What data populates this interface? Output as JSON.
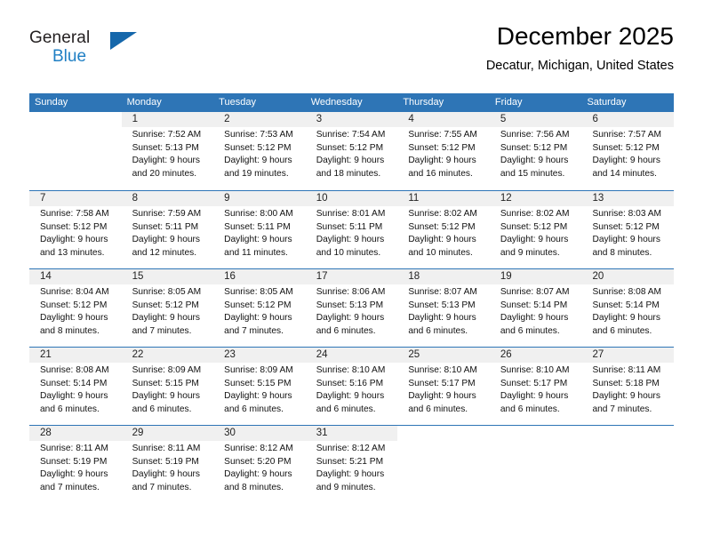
{
  "brand": {
    "name_part1": "General",
    "name_part2": "Blue",
    "triangle_color": "#1567ab",
    "blue_color": "#1f7fc4"
  },
  "header": {
    "title": "December 2025",
    "subtitle": "Decatur, Michigan, United States"
  },
  "theme": {
    "header_row_bg": "#2e75b6",
    "day_band_bg": "#f0f0f0",
    "separator_color": "#2e75b6",
    "page_bg": "#ffffff"
  },
  "weekdays": [
    "Sunday",
    "Monday",
    "Tuesday",
    "Wednesday",
    "Thursday",
    "Friday",
    "Saturday"
  ],
  "weeks": [
    [
      {
        "day": "",
        "l1": "",
        "l2": "",
        "l3": "",
        "l4": ""
      },
      {
        "day": "1",
        "l1": "Sunrise: 7:52 AM",
        "l2": "Sunset: 5:13 PM",
        "l3": "Daylight: 9 hours",
        "l4": "and 20 minutes."
      },
      {
        "day": "2",
        "l1": "Sunrise: 7:53 AM",
        "l2": "Sunset: 5:12 PM",
        "l3": "Daylight: 9 hours",
        "l4": "and 19 minutes."
      },
      {
        "day": "3",
        "l1": "Sunrise: 7:54 AM",
        "l2": "Sunset: 5:12 PM",
        "l3": "Daylight: 9 hours",
        "l4": "and 18 minutes."
      },
      {
        "day": "4",
        "l1": "Sunrise: 7:55 AM",
        "l2": "Sunset: 5:12 PM",
        "l3": "Daylight: 9 hours",
        "l4": "and 16 minutes."
      },
      {
        "day": "5",
        "l1": "Sunrise: 7:56 AM",
        "l2": "Sunset: 5:12 PM",
        "l3": "Daylight: 9 hours",
        "l4": "and 15 minutes."
      },
      {
        "day": "6",
        "l1": "Sunrise: 7:57 AM",
        "l2": "Sunset: 5:12 PM",
        "l3": "Daylight: 9 hours",
        "l4": "and 14 minutes."
      }
    ],
    [
      {
        "day": "7",
        "l1": "Sunrise: 7:58 AM",
        "l2": "Sunset: 5:12 PM",
        "l3": "Daylight: 9 hours",
        "l4": "and 13 minutes."
      },
      {
        "day": "8",
        "l1": "Sunrise: 7:59 AM",
        "l2": "Sunset: 5:11 PM",
        "l3": "Daylight: 9 hours",
        "l4": "and 12 minutes."
      },
      {
        "day": "9",
        "l1": "Sunrise: 8:00 AM",
        "l2": "Sunset: 5:11 PM",
        "l3": "Daylight: 9 hours",
        "l4": "and 11 minutes."
      },
      {
        "day": "10",
        "l1": "Sunrise: 8:01 AM",
        "l2": "Sunset: 5:11 PM",
        "l3": "Daylight: 9 hours",
        "l4": "and 10 minutes."
      },
      {
        "day": "11",
        "l1": "Sunrise: 8:02 AM",
        "l2": "Sunset: 5:12 PM",
        "l3": "Daylight: 9 hours",
        "l4": "and 10 minutes."
      },
      {
        "day": "12",
        "l1": "Sunrise: 8:02 AM",
        "l2": "Sunset: 5:12 PM",
        "l3": "Daylight: 9 hours",
        "l4": "and 9 minutes."
      },
      {
        "day": "13",
        "l1": "Sunrise: 8:03 AM",
        "l2": "Sunset: 5:12 PM",
        "l3": "Daylight: 9 hours",
        "l4": "and 8 minutes."
      }
    ],
    [
      {
        "day": "14",
        "l1": "Sunrise: 8:04 AM",
        "l2": "Sunset: 5:12 PM",
        "l3": "Daylight: 9 hours",
        "l4": "and 8 minutes."
      },
      {
        "day": "15",
        "l1": "Sunrise: 8:05 AM",
        "l2": "Sunset: 5:12 PM",
        "l3": "Daylight: 9 hours",
        "l4": "and 7 minutes."
      },
      {
        "day": "16",
        "l1": "Sunrise: 8:05 AM",
        "l2": "Sunset: 5:12 PM",
        "l3": "Daylight: 9 hours",
        "l4": "and 7 minutes."
      },
      {
        "day": "17",
        "l1": "Sunrise: 8:06 AM",
        "l2": "Sunset: 5:13 PM",
        "l3": "Daylight: 9 hours",
        "l4": "and 6 minutes."
      },
      {
        "day": "18",
        "l1": "Sunrise: 8:07 AM",
        "l2": "Sunset: 5:13 PM",
        "l3": "Daylight: 9 hours",
        "l4": "and 6 minutes."
      },
      {
        "day": "19",
        "l1": "Sunrise: 8:07 AM",
        "l2": "Sunset: 5:14 PM",
        "l3": "Daylight: 9 hours",
        "l4": "and 6 minutes."
      },
      {
        "day": "20",
        "l1": "Sunrise: 8:08 AM",
        "l2": "Sunset: 5:14 PM",
        "l3": "Daylight: 9 hours",
        "l4": "and 6 minutes."
      }
    ],
    [
      {
        "day": "21",
        "l1": "Sunrise: 8:08 AM",
        "l2": "Sunset: 5:14 PM",
        "l3": "Daylight: 9 hours",
        "l4": "and 6 minutes."
      },
      {
        "day": "22",
        "l1": "Sunrise: 8:09 AM",
        "l2": "Sunset: 5:15 PM",
        "l3": "Daylight: 9 hours",
        "l4": "and 6 minutes."
      },
      {
        "day": "23",
        "l1": "Sunrise: 8:09 AM",
        "l2": "Sunset: 5:15 PM",
        "l3": "Daylight: 9 hours",
        "l4": "and 6 minutes."
      },
      {
        "day": "24",
        "l1": "Sunrise: 8:10 AM",
        "l2": "Sunset: 5:16 PM",
        "l3": "Daylight: 9 hours",
        "l4": "and 6 minutes."
      },
      {
        "day": "25",
        "l1": "Sunrise: 8:10 AM",
        "l2": "Sunset: 5:17 PM",
        "l3": "Daylight: 9 hours",
        "l4": "and 6 minutes."
      },
      {
        "day": "26",
        "l1": "Sunrise: 8:10 AM",
        "l2": "Sunset: 5:17 PM",
        "l3": "Daylight: 9 hours",
        "l4": "and 6 minutes."
      },
      {
        "day": "27",
        "l1": "Sunrise: 8:11 AM",
        "l2": "Sunset: 5:18 PM",
        "l3": "Daylight: 9 hours",
        "l4": "and 7 minutes."
      }
    ],
    [
      {
        "day": "28",
        "l1": "Sunrise: 8:11 AM",
        "l2": "Sunset: 5:19 PM",
        "l3": "Daylight: 9 hours",
        "l4": "and 7 minutes."
      },
      {
        "day": "29",
        "l1": "Sunrise: 8:11 AM",
        "l2": "Sunset: 5:19 PM",
        "l3": "Daylight: 9 hours",
        "l4": "and 7 minutes."
      },
      {
        "day": "30",
        "l1": "Sunrise: 8:12 AM",
        "l2": "Sunset: 5:20 PM",
        "l3": "Daylight: 9 hours",
        "l4": "and 8 minutes."
      },
      {
        "day": "31",
        "l1": "Sunrise: 8:12 AM",
        "l2": "Sunset: 5:21 PM",
        "l3": "Daylight: 9 hours",
        "l4": "and 9 minutes."
      },
      {
        "day": "",
        "l1": "",
        "l2": "",
        "l3": "",
        "l4": ""
      },
      {
        "day": "",
        "l1": "",
        "l2": "",
        "l3": "",
        "l4": ""
      },
      {
        "day": "",
        "l1": "",
        "l2": "",
        "l3": "",
        "l4": ""
      }
    ]
  ]
}
